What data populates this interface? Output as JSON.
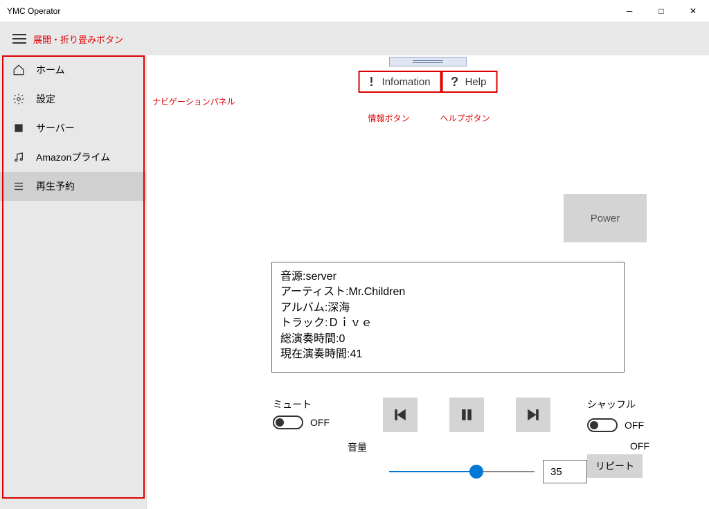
{
  "window": {
    "title": "YMC Operator"
  },
  "expand_label": "展開・折り畳みボタン",
  "annotations": {
    "nav_panel": "ナビゲーションパネル",
    "info_btn": "情報ボタン",
    "help_btn": "ヘルプボタン"
  },
  "sidebar": {
    "items": [
      {
        "label": "ホーム",
        "icon": "home-icon",
        "selected": false
      },
      {
        "label": "設定",
        "icon": "gear-icon",
        "selected": false
      },
      {
        "label": "サーバー",
        "icon": "server-icon",
        "selected": false
      },
      {
        "label": "Amazonプライム",
        "icon": "music-note-icon",
        "selected": false
      },
      {
        "label": "再生予約",
        "icon": "list-icon",
        "selected": true
      }
    ]
  },
  "top_buttons": {
    "info_label": "Infomation",
    "help_label": "Help"
  },
  "power_label": "Power",
  "track_info": {
    "source_line": "音源:server",
    "artist_line": "アーティスト:Mr.Children",
    "album_line": "アルバム:深海",
    "track_line": "トラック:Ｄｉｖｅ",
    "total_time_line": "総演奏時間:0",
    "current_time_line": "現在演奏時間:41"
  },
  "controls": {
    "mute_label": "ミュート",
    "mute_state": "OFF",
    "volume_label": "音量",
    "volume_value": "35",
    "volume_percent": 60,
    "shuffle_label": "シャッフル",
    "shuffle_state": "OFF",
    "repeat_state": "OFF",
    "repeat_label": "リピート"
  }
}
